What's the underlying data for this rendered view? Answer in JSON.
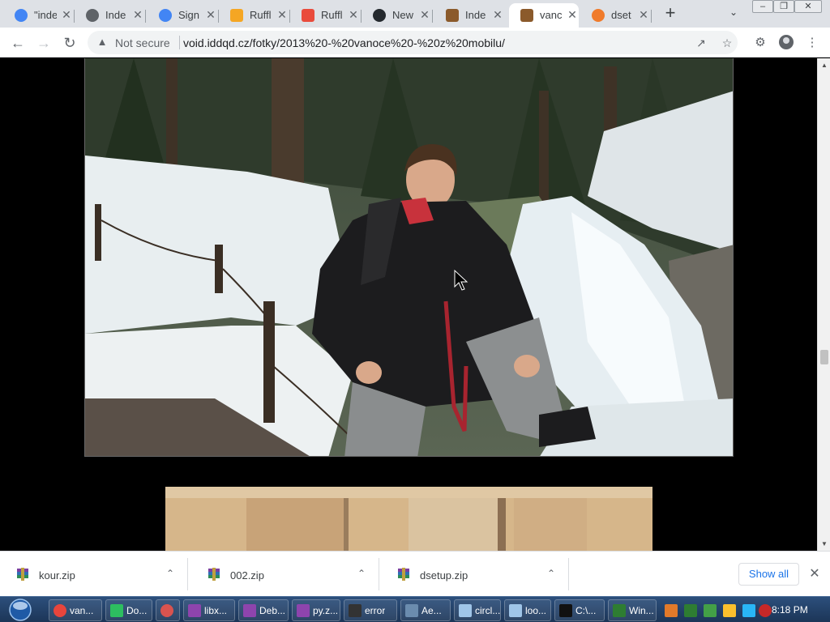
{
  "tabs": [
    {
      "title": "\"inde",
      "favicon": "google-icon",
      "color": "#4285f4"
    },
    {
      "title": "Inde",
      "favicon": "globe-icon",
      "color": "#5f6368"
    },
    {
      "title": "Sign",
      "favicon": "google-icon",
      "color": "#4285f4"
    },
    {
      "title": "Ruffl",
      "favicon": "ruffle-icon",
      "color": "#f5a623"
    },
    {
      "title": "Ruffl",
      "favicon": "ruffle-rainbow-icon",
      "color": "#e94b3c"
    },
    {
      "title": "New",
      "favicon": "github-icon",
      "color": "#24292e"
    },
    {
      "title": "Inde",
      "favicon": "photo-icon",
      "color": "#8b5a2b"
    },
    {
      "title": "vanc",
      "favicon": "photo-icon",
      "color": "#8b5a2b",
      "active": true
    },
    {
      "title": "dset",
      "favicon": "gear-orange-icon",
      "color": "#f07b2b"
    }
  ],
  "toolbar": {
    "security_label": "Not secure",
    "url": "void.iddqd.cz/fotky/2013%20-%20vanoce%20-%20z%20mobilu/"
  },
  "downloads": [
    {
      "name": "kour.zip"
    },
    {
      "name": "002.zip"
    },
    {
      "name": "dsetup.zip"
    }
  ],
  "shelf": {
    "show_all": "Show all"
  },
  "taskbar": {
    "buttons": [
      {
        "label": "van...",
        "icon": "chrome-icon",
        "color": "#e8453c"
      },
      {
        "label": "Do...",
        "icon": "evernote-icon",
        "color": "#2dbe60"
      },
      {
        "label": "",
        "icon": "media-player-icon",
        "color": "#d9534f"
      },
      {
        "label": "libx...",
        "icon": "winrar-icon",
        "color": "#8e44ad"
      },
      {
        "label": "Deb...",
        "icon": "winrar-icon",
        "color": "#8e44ad"
      },
      {
        "label": "py.z...",
        "icon": "winrar-icon",
        "color": "#8e44ad"
      },
      {
        "label": "error",
        "icon": "console-icon",
        "color": "#333333"
      },
      {
        "label": "Ae...",
        "icon": "document-icon",
        "color": "#6b8cae"
      },
      {
        "label": "circl...",
        "icon": "notepad-icon",
        "color": "#9fc5e8"
      },
      {
        "label": "loo...",
        "icon": "notepad-icon",
        "color": "#9fc5e8"
      },
      {
        "label": "C:\\...",
        "icon": "cmd-icon",
        "color": "#111111"
      },
      {
        "label": "Win...",
        "icon": "terminal-icon",
        "color": "#2e7d32"
      }
    ],
    "clock": "8:18 PM"
  }
}
